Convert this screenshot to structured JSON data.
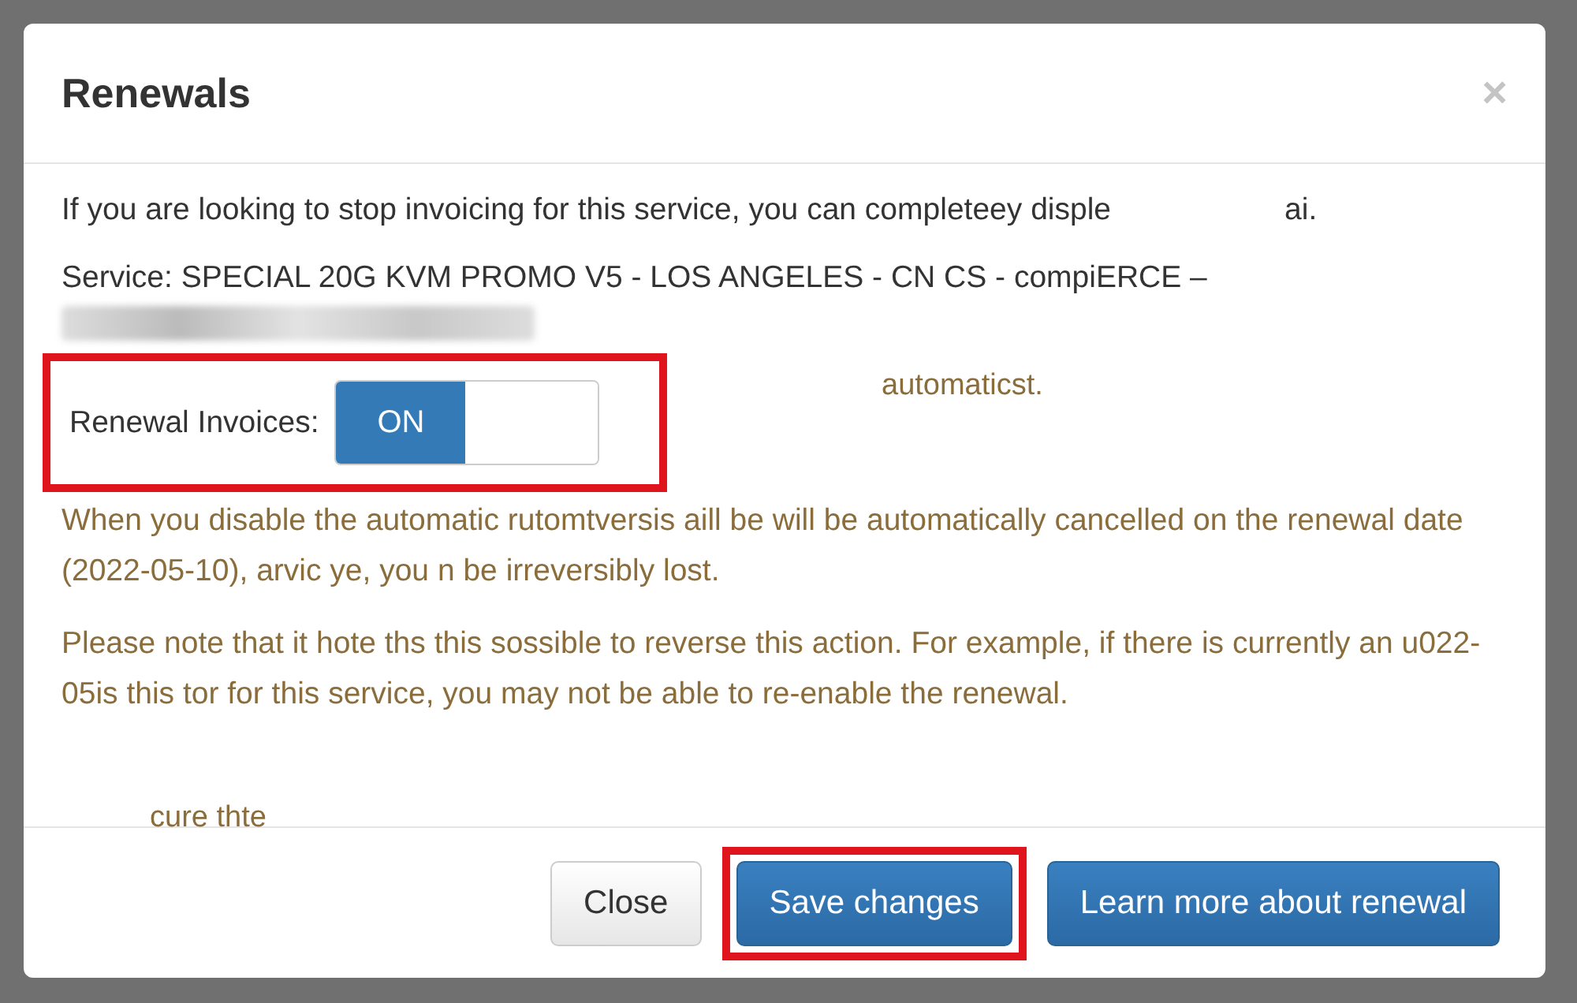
{
  "dialog": {
    "title": "Renewals",
    "close_icon": "×"
  },
  "intro": "If you are looking to stop invoicing for this service, you can completeey disple",
  "intro_tail": "ai.",
  "service": "Service: SPECIAL 20G KVM PROMO V5 - LOS ANGELES - CN CS -    compiERCE –",
  "toggle": {
    "label": "Renewal Invoices:",
    "on_text": "ON",
    "on": true,
    "highlighted": true
  },
  "floating_note": "automaticst.",
  "warnings": [
    "When you disable the automatic rutomtversis aill be will be automatically cancelled on the renewal date (2022-05-10), arvic ye, you n be irreversibly lost.",
    "Please note that it hote ths  this sossible to reverse this action. For example, if there is currently an u022-05is this tor for this service, you may not be able to re-enable the renewal."
  ],
  "stray_text": "cure thte",
  "buttons": [
    {
      "label": "Close",
      "kind": "default",
      "highlighted": false
    },
    {
      "label": "Save changes",
      "kind": "primary",
      "highlighted": true
    },
    {
      "label": "Learn more about renewal",
      "kind": "primary",
      "highlighted": false
    }
  ]
}
